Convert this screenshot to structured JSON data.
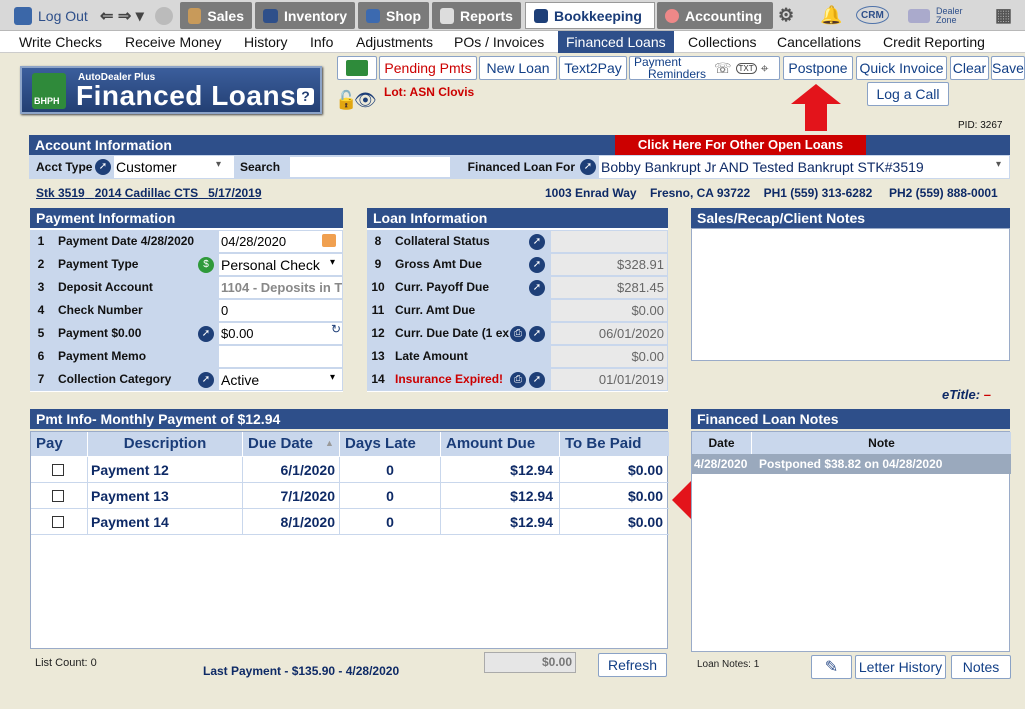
{
  "topnav": {
    "logout": "Log Out",
    "items": [
      "Sales",
      "Inventory",
      "Shop",
      "Reports",
      "Bookkeeping",
      "Accounting"
    ],
    "crm": "CRM",
    "dealer_zone_1": "Dealer",
    "dealer_zone_2": "Zone"
  },
  "subnav": [
    "Write Checks",
    "Receive Money",
    "History",
    "Info",
    "Adjustments",
    "POs / Invoices",
    "Financed Loans",
    "Collections",
    "Cancellations",
    "Credit Reporting"
  ],
  "logo": {
    "brand": "AutoDealer Plus",
    "badge": "BHPH",
    "title": "Financed Loans",
    "help": "?"
  },
  "toolbar": {
    "pending": "Pending Pmts",
    "new_loan": "New Loan",
    "text2pay": "Text2Pay",
    "payment_reminders_1": "Payment",
    "payment_reminders_2": "Reminders",
    "txt": "TXT",
    "postpone": "Postpone",
    "quick_invoice": "Quick Invoice",
    "clear": "Clear",
    "save": "Save",
    "log_call": "Log a Call"
  },
  "lot": "Lot: ASN Clovis",
  "pid": "PID: 3267",
  "account": {
    "header": "Account Information",
    "other_loans": "Click Here For Other Open Loans",
    "acct_type_label": "Acct Type",
    "acct_type_value": "Customer",
    "search_label": "Search",
    "search_value": "",
    "financed_for_label": "Financed Loan For",
    "financed_for_value": "Bobby Bankrupt Jr AND Tested Bankrupt STK#3519",
    "stk": "Stk 3519",
    "vehicle": "2014 Cadillac CTS",
    "date": "5/17/2019",
    "address": "1003 Enrad Way",
    "city": "Fresno, CA 93722",
    "ph1": "PH1 (559) 313-6282",
    "ph2": "PH2 (559) 888-0001"
  },
  "payment_info": {
    "header": "Payment Information",
    "rows": [
      {
        "n": "1",
        "label": "Payment Date  4/28/2020",
        "value": "04/28/2020"
      },
      {
        "n": "2",
        "label": "Payment Type",
        "value": "Personal Check"
      },
      {
        "n": "3",
        "label": "Deposit Account",
        "value": "1104 - Deposits in T"
      },
      {
        "n": "4",
        "label": "Check Number",
        "value": "0"
      },
      {
        "n": "5",
        "label": "Payment  $0.00",
        "value": "$0.00"
      },
      {
        "n": "6",
        "label": "Payment Memo",
        "value": ""
      },
      {
        "n": "7",
        "label": "Collection Category",
        "value": "Active"
      }
    ]
  },
  "loan_info": {
    "header": "Loan Information",
    "rows": [
      {
        "n": "8",
        "label": "Collateral Status",
        "value": ""
      },
      {
        "n": "9",
        "label": "Gross Amt Due",
        "value": "$328.91"
      },
      {
        "n": "10",
        "label": "Curr. Payoff Due",
        "value": "$281.45"
      },
      {
        "n": "11",
        "label": "Curr. Amt Due",
        "value": "$0.00"
      },
      {
        "n": "12",
        "label": "Curr. Due Date (1 ex",
        "value": "06/01/2020"
      },
      {
        "n": "13",
        "label": "Late Amount",
        "value": "$0.00"
      },
      {
        "n": "14",
        "label": "Insurance Expired!",
        "value": "01/01/2019"
      }
    ]
  },
  "notes_panel": {
    "header": "Sales/Recap/Client Notes"
  },
  "etitle": {
    "label": "eTitle:",
    "value": "–"
  },
  "pmt_info": {
    "header": "Pmt Info- Monthly Payment of $12.94",
    "columns": [
      "Pay",
      "Description",
      "Due Date",
      "Days Late",
      "Amount Due",
      "To Be Paid"
    ],
    "rows": [
      {
        "desc": "Payment 12",
        "due": "6/1/2020",
        "late": "0",
        "amount": "$12.94",
        "paid": "$0.00"
      },
      {
        "desc": "Payment 13",
        "due": "7/1/2020",
        "late": "0",
        "amount": "$12.94",
        "paid": "$0.00"
      },
      {
        "desc": "Payment 14",
        "due": "8/1/2020",
        "late": "0",
        "amount": "$12.94",
        "paid": "$0.00"
      }
    ],
    "list_count": "List Count:  0",
    "last_payment": "Last Payment - $135.90 - 4/28/2020",
    "total": "$0.00",
    "refresh": "Refresh"
  },
  "loan_notes": {
    "header": "Financed Loan Notes",
    "col_date": "Date",
    "col_note": "Note",
    "rows": [
      {
        "date": "4/28/2020",
        "note": "Postponed $38.82 on 04/28/2020"
      }
    ],
    "count": "Loan Notes:  1",
    "letter_history": "Letter History",
    "notes": "Notes"
  },
  "colors": {
    "navy": "#2e4f8a",
    "red": "#cc0000",
    "light": "#c9d7ec"
  }
}
